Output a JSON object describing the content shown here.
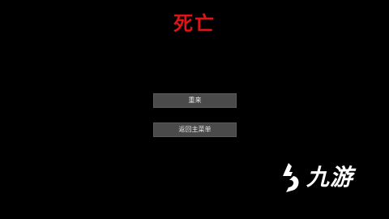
{
  "screen": {
    "title": "死亡",
    "title_color": "#e01414",
    "background_color": "#000000"
  },
  "menu": {
    "retry_label": "重来",
    "main_menu_label": "返回主菜单",
    "button_color": "#4a4a4a"
  },
  "watermark": {
    "text": "九游",
    "icon": "nine-game-logo-icon"
  }
}
